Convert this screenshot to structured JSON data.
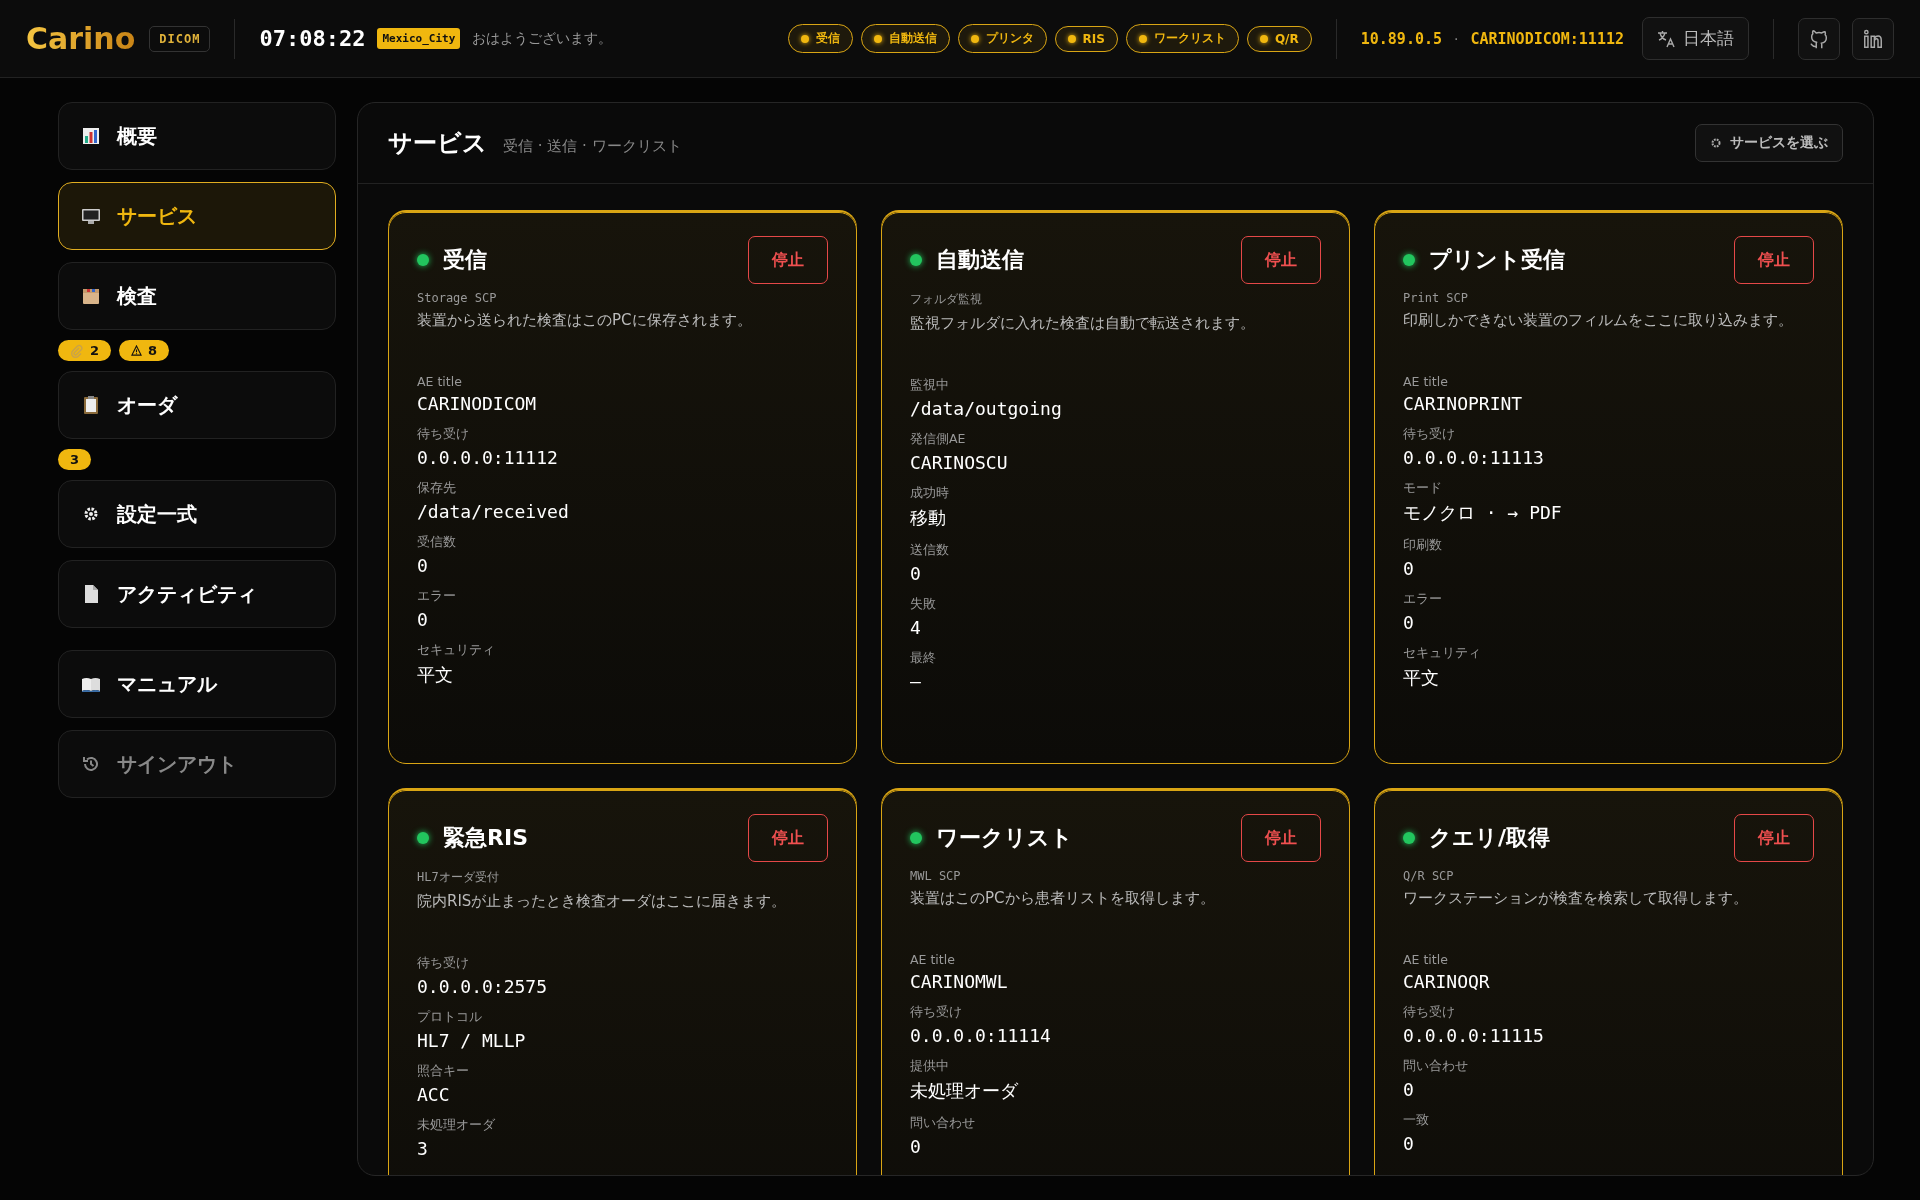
{
  "header": {
    "logo": "Carino",
    "badge": "DICOM",
    "time": "07:08:22",
    "timezone": "Mexico_City",
    "greeting": "おはようございます。",
    "services": [
      {
        "label": "受信"
      },
      {
        "label": "自動送信"
      },
      {
        "label": "プリンタ"
      },
      {
        "label": "RIS"
      },
      {
        "label": "ワークリスト"
      },
      {
        "label": "Q/R"
      }
    ],
    "address": "10.89.0.5",
    "separator": "·",
    "ae_port": "CARINODICOM:11112",
    "language": "日本語"
  },
  "sidebar": {
    "items": [
      {
        "label": "概要",
        "selected": false,
        "dimmed": false
      },
      {
        "label": "サービス",
        "selected": true,
        "dimmed": false
      },
      {
        "label": "検査",
        "selected": false,
        "dimmed": false,
        "badges": [
          {
            "kind": "attachment",
            "count": "2"
          },
          {
            "kind": "warning",
            "count": "8"
          }
        ]
      },
      {
        "label": "オーダ",
        "selected": false,
        "dimmed": false,
        "badges": [
          {
            "kind": "count",
            "count": "3"
          }
        ]
      },
      {
        "label": "設定一式",
        "selected": false,
        "dimmed": false
      },
      {
        "label": "アクティビティ",
        "selected": false,
        "dimmed": false
      },
      {
        "label": "マニュアル",
        "selected": false,
        "dimmed": false
      },
      {
        "label": "サインアウト",
        "selected": false,
        "dimmed": true
      }
    ]
  },
  "panel": {
    "title": "サービス",
    "subtitle": "受信 · 送信 · ワークリスト",
    "choose_button": "サービスを選ぶ",
    "cards": [
      {
        "title": "受信",
        "running": true,
        "stop": "停止",
        "type": "Storage SCP",
        "description": "装置から送られた検査はこのPCに保存されます。",
        "fields": [
          {
            "label": "AE title",
            "value": "CARINODICOM"
          },
          {
            "label": "待ち受け",
            "value": "0.0.0.0:11112"
          },
          {
            "label": "保存先",
            "value": "/data/received"
          },
          {
            "label": "受信数",
            "value": "0"
          },
          {
            "label": "エラー",
            "value": "0"
          },
          {
            "label": "セキュリティ",
            "value": "平文"
          }
        ]
      },
      {
        "title": "自動送信",
        "running": true,
        "stop": "停止",
        "type": "フォルダ監視",
        "description": "監視フォルダに入れた検査は自動で転送されます。",
        "fields": [
          {
            "label": "監視中",
            "value": "/data/outgoing"
          },
          {
            "label": "発信側AE",
            "value": "CARINOSCU"
          },
          {
            "label": "成功時",
            "value": "移動"
          },
          {
            "label": "送信数",
            "value": "0"
          },
          {
            "label": "失敗",
            "value": "4"
          },
          {
            "label": "最終",
            "value": "—"
          }
        ]
      },
      {
        "title": "プリント受信",
        "running": true,
        "stop": "停止",
        "type": "Print SCP",
        "description": "印刷しかできない装置のフィルムをここに取り込みます。",
        "fields": [
          {
            "label": "AE title",
            "value": "CARINOPRINT"
          },
          {
            "label": "待ち受け",
            "value": "0.0.0.0:11113"
          },
          {
            "label": "モード",
            "value": "モノクロ · → PDF"
          },
          {
            "label": "印刷数",
            "value": "0"
          },
          {
            "label": "エラー",
            "value": "0"
          },
          {
            "label": "セキュリティ",
            "value": "平文"
          }
        ]
      },
      {
        "title": "緊急RIS",
        "running": true,
        "stop": "停止",
        "type": "HL7オーダ受付",
        "description": "院内RISが止まったとき検査オーダはここに届きます。",
        "fields": [
          {
            "label": "待ち受け",
            "value": "0.0.0.0:2575"
          },
          {
            "label": "プロトコル",
            "value": "HL7 / MLLP"
          },
          {
            "label": "照合キー",
            "value": "ACC"
          },
          {
            "label": "未処理オーダ",
            "value": "3"
          }
        ]
      },
      {
        "title": "ワークリスト",
        "running": true,
        "stop": "停止",
        "type": "MWL SCP",
        "description": "装置はこのPCから患者リストを取得します。",
        "fields": [
          {
            "label": "AE title",
            "value": "CARINOMWL"
          },
          {
            "label": "待ち受け",
            "value": "0.0.0.0:11114"
          },
          {
            "label": "提供中",
            "value": "未処理オーダ"
          },
          {
            "label": "問い合わせ",
            "value": "0"
          }
        ]
      },
      {
        "title": "クエリ/取得",
        "running": true,
        "stop": "停止",
        "type": "Q/R SCP",
        "description": "ワークステーションが検査を検索して取得します。",
        "fields": [
          {
            "label": "AE title",
            "value": "CARINOQR"
          },
          {
            "label": "待ち受け",
            "value": "0.0.0.0:11115"
          },
          {
            "label": "問い合わせ",
            "value": "0"
          },
          {
            "label": "一致",
            "value": "0"
          }
        ]
      }
    ]
  }
}
